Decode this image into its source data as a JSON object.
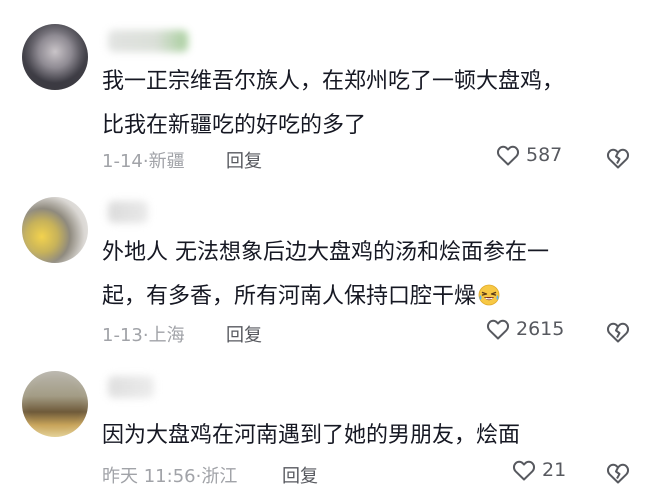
{
  "comments": [
    {
      "line1": "我一正宗维吾尔族人，在郑州吃了一顿大盘鸡，",
      "line2": "比我在新疆吃的好吃的多了",
      "meta": "1-14·新疆",
      "reply_label": "回复",
      "likes": "587",
      "icons": [
        "avatar",
        "heart-icon",
        "broken-heart-icon"
      ]
    },
    {
      "line1": "外地人 无法想象后边大盘鸡的汤和烩面参在一",
      "line2": "起，有多香，所有河南人保持口腔干燥",
      "emoji": "laughing-crying-emoji",
      "meta": "1-13·上海",
      "reply_label": "回复",
      "likes": "2615",
      "icons": [
        "avatar",
        "heart-icon",
        "broken-heart-icon"
      ]
    },
    {
      "line1": "因为大盘鸡在河南遇到了她的男朋友，烩面",
      "meta": "昨天 11:56·浙江",
      "reply_label": "回复",
      "likes": "21",
      "icons": [
        "avatar",
        "heart-icon",
        "broken-heart-icon"
      ]
    }
  ],
  "colors": {
    "text": "#161823",
    "meta": "#a1a3a8",
    "action": "#57595f",
    "background": "#ffffff"
  }
}
